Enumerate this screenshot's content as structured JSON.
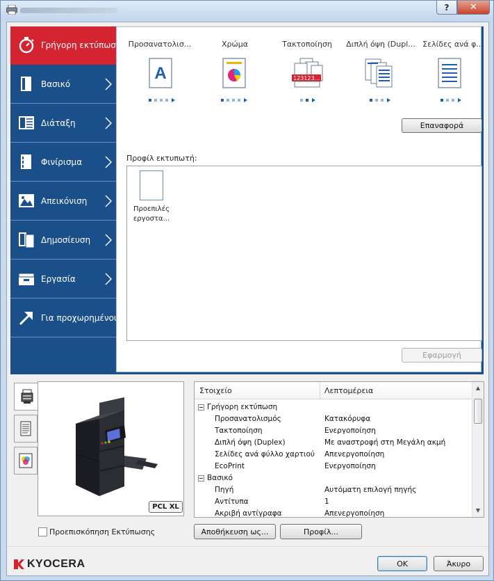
{
  "window": {
    "help_glyph": "?",
    "close_glyph": "✕"
  },
  "nav": {
    "items": [
      {
        "label": "Γρήγορη εκτύπωση",
        "icon": "stopwatch-icon"
      },
      {
        "label": "Βασικό",
        "icon": "document-icon"
      },
      {
        "label": "Διάταξη",
        "icon": "layout-icon"
      },
      {
        "label": "Φινίρισμα",
        "icon": "finishing-icon"
      },
      {
        "label": "Απεικόνιση",
        "icon": "image-icon"
      },
      {
        "label": "Δημοσίευση",
        "icon": "publishing-icon"
      },
      {
        "label": "Εργασία",
        "icon": "job-icon"
      },
      {
        "label": "Για προχωρημένους",
        "icon": "advanced-arrow-icon"
      }
    ],
    "active_color": "#d42331",
    "panel_color": "#1b4f8a"
  },
  "quick_print": {
    "options": [
      {
        "label": "Προσανατολισ...",
        "icon": "orientation-icon"
      },
      {
        "label": "Χρώμα",
        "icon": "color-icon"
      },
      {
        "label": "Τακτοποίηση",
        "icon": "collate-icon"
      },
      {
        "label": "Διπλή όψη (Dupl...",
        "icon": "duplex-icon"
      },
      {
        "label": "Σελίδες ανά φ...",
        "icon": "pages-per-sheet-icon"
      }
    ],
    "reset_button": "Επαναφορά",
    "orientation_glyph": "A",
    "collate_digits": "123123..."
  },
  "profile": {
    "label": "Προφίλ εκτυπωτή:",
    "items": [
      {
        "name_line1": "Προεπιλές",
        "name_line2": "εργοστα..."
      }
    ],
    "apply_button": "Εφαρμογή"
  },
  "printer_preview": {
    "badge": "PCL XL",
    "tabs": [
      "printer-tab-icon",
      "page-tab-icon",
      "color-tab-icon"
    ]
  },
  "details": {
    "headers": {
      "item": "Στοιχείο",
      "details": "Λεπτομέρεια"
    },
    "rows": [
      {
        "group": true,
        "key": "Γρήγορη εκτύπωση",
        "value": ""
      },
      {
        "group": false,
        "key": "Προσανατολισμός",
        "value": "Κατακόρυφα"
      },
      {
        "group": false,
        "key": "Τακτοποίηση",
        "value": "Ενεργοποίηση"
      },
      {
        "group": false,
        "key": "Διπλή όψη (Duplex)",
        "value": "Με αναστροφή στη Μεγάλη ακμή"
      },
      {
        "group": false,
        "key": "Σελίδες ανά φύλλο χαρτιού",
        "value": "Απενεργοποίηση"
      },
      {
        "group": false,
        "key": "EcoPrint",
        "value": "Ενεργοποίηση"
      },
      {
        "group": true,
        "key": "Βασικό",
        "value": ""
      },
      {
        "group": false,
        "key": "Πηγή",
        "value": "Αυτόματη επιλογή πηγής"
      },
      {
        "group": false,
        "key": "Αντίτυπα",
        "value": "1"
      },
      {
        "group": false,
        "key": "Ακριβή αντίγραφα",
        "value": "Απενεργοποίηση"
      }
    ]
  },
  "bottom": {
    "preview_checkbox": "Προεπισκόπηση Εκτύπωσης",
    "save_as_button": "Αποθήκευση ως...",
    "profile_button": "Προφίλ...",
    "ok_button": "OK",
    "cancel_button": "Άκυρο",
    "logo": "KYOCERA",
    "logo_color": "#d42331"
  }
}
